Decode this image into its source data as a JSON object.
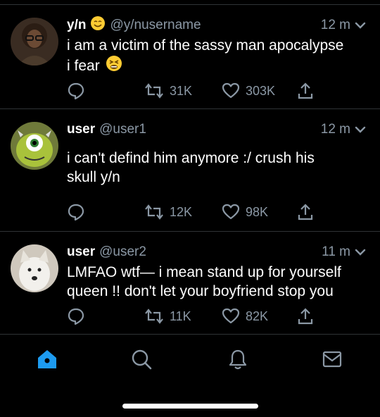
{
  "tweets": [
    {
      "name": "y/n",
      "handle": "@y/nusername",
      "time": "12 m",
      "text_line1": "i am a victim of the sassy man apocalypse",
      "text_line2": "i fear",
      "replies": "",
      "retweets": "31K",
      "likes": "303K"
    },
    {
      "name": "user",
      "handle": "@user1",
      "time": "12 m",
      "text_line1": "i can't defind him anymore :/ crush his",
      "text_line2": "skull y/n",
      "replies": "",
      "retweets": "12K",
      "likes": "98K"
    },
    {
      "name": "user",
      "handle": "@user2",
      "time": "11 m",
      "text_line1": "LMFAO wtf— i mean stand up for yourself",
      "text_line2": "queen !! don't let your boyfriend stop you",
      "replies": "",
      "retweets": "11K",
      "likes": "82K"
    }
  ],
  "tabs": [
    "home-icon",
    "search-icon",
    "notifications-icon",
    "messages-icon"
  ],
  "colors": {
    "background": "#000000",
    "secondary_text": "#8b98a5",
    "accent": "#1d9bf0",
    "divider": "#2f3336"
  }
}
